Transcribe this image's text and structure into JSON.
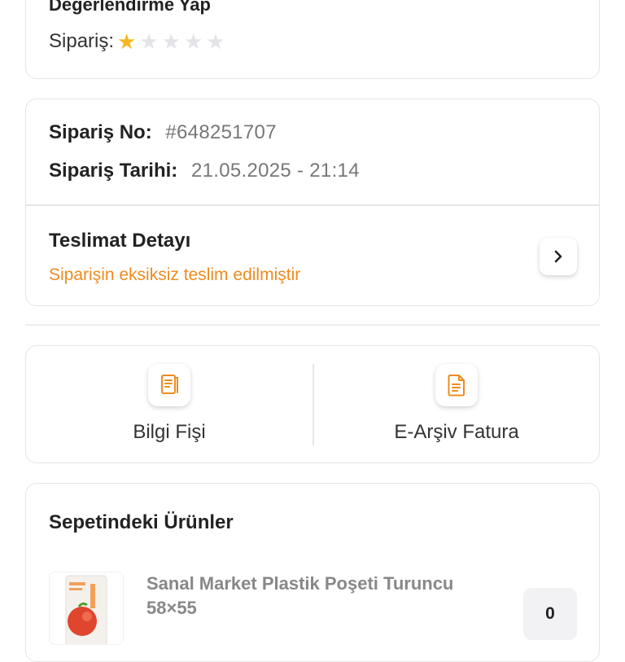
{
  "rating": {
    "title": "Değerlendirme Yap",
    "label": "Sipariş:",
    "value": 1,
    "max": 5,
    "star_color": "#f6b81e"
  },
  "order": {
    "number_label": "Sipariş No:",
    "number_value": "#648251707",
    "date_label": "Sipariş Tarihi:",
    "date_value": "21.05.2025 - 21:14"
  },
  "delivery": {
    "title": "Teslimat Detayı",
    "status": "Siparişin eksiksiz teslim edilmiştir",
    "status_color": "#ef8b1f",
    "icon": "chevron-right-icon"
  },
  "documents": [
    {
      "label": "Bilgi Fişi",
      "icon": "receipt-icon"
    },
    {
      "label": "E-Arşiv Fatura",
      "icon": "invoice-document-icon"
    }
  ],
  "cart": {
    "title": "Sepetindeki Ürünler",
    "items": [
      {
        "name": "Sanal Market Plastik Poşeti Turuncu 58×55",
        "quantity": "0"
      }
    ]
  },
  "accent_color": "#ef8b1f"
}
